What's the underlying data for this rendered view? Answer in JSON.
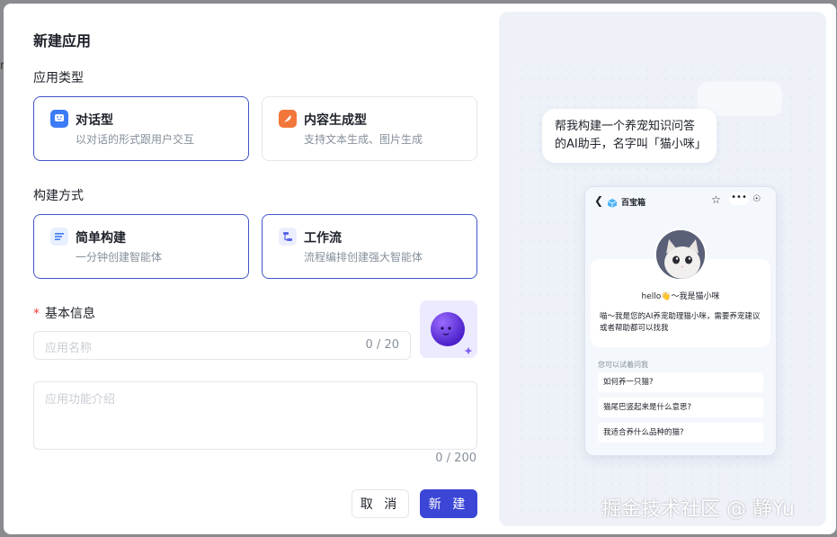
{
  "dialog": {
    "title": "新建应用",
    "app_type_label": "应用类型",
    "build_method_label": "构建方式",
    "basic_info_label": "基本信息",
    "required_mark": "*"
  },
  "app_types": [
    {
      "name": "对话型",
      "desc": "以对话的形式跟用户交互",
      "selected": true,
      "icon": "chat-icon",
      "color": "#3c7cf6"
    },
    {
      "name": "内容生成型",
      "desc": "支持文本生成、图片生成",
      "selected": false,
      "icon": "feather-icon",
      "color": "#f2773a"
    }
  ],
  "build_methods": [
    {
      "name": "简单构建",
      "desc": "一分钟创建智能体",
      "selected": true,
      "icon": "list-icon",
      "color": "#3c7cf6"
    },
    {
      "name": "工作流",
      "desc": "流程编排创建强大智能体",
      "selected": true,
      "icon": "workflow-icon",
      "color": "#5a64e6"
    }
  ],
  "form": {
    "name_placeholder": "应用名称",
    "name_count": "0 / 20",
    "desc_placeholder": "应用功能介绍",
    "desc_count": "0 / 200"
  },
  "buttons": {
    "cancel": "取 消",
    "create": "新 建"
  },
  "preview": {
    "prompt_bubble": "帮我构建一个养宠知识问答的AI助手，名字叫「猫小咪」",
    "phone_app_name": "百宝箱",
    "hello": "hello👋～我是猫小咪",
    "intro_msg": "喵～我是您的AI养宠助理猫小咪，需要养宠建议或者帮助都可以找我",
    "suggest_title": "您可以试着问我",
    "suggestions": [
      "如何养一只猫?",
      "猫尾巴竖起来是什么意思?",
      "我适合养什么品种的猫?"
    ]
  },
  "watermark": "掘金技术社区 @ 静Yu",
  "edge_text": "n"
}
